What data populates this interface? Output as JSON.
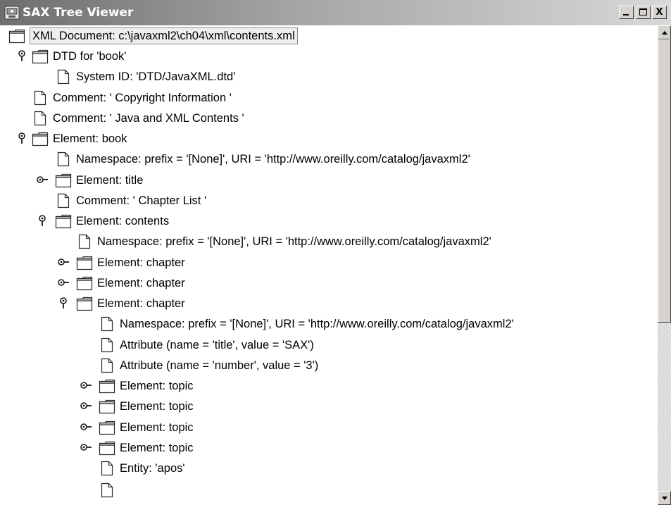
{
  "window": {
    "title": "SAX Tree Viewer",
    "buttons": {
      "minimize": "_",
      "maximize": "□",
      "close": "X"
    }
  },
  "tree": {
    "nodes": [
      {
        "label": "XML Document: c:\\javaxml2\\ch04\\xml\\contents.xml",
        "type": "folder",
        "depth": 0,
        "toggle": "none",
        "selected": true
      },
      {
        "label": "DTD for 'book'",
        "type": "folder",
        "depth": 0,
        "toggle": "expanded"
      },
      {
        "label": "System ID: 'DTD/JavaXML.dtd'",
        "type": "leaf",
        "depth": 1,
        "toggle": "none"
      },
      {
        "label": "Comment: ' Copyright Information '",
        "type": "leaf",
        "depth": 0,
        "toggle": "none"
      },
      {
        "label": "Comment: ' Java and XML Contents '",
        "type": "leaf",
        "depth": 0,
        "toggle": "none"
      },
      {
        "label": "Element: book",
        "type": "folder",
        "depth": 0,
        "toggle": "expanded"
      },
      {
        "label": "Namespace: prefix = '[None]', URI = 'http://www.oreilly.com/catalog/javaxml2'",
        "type": "leaf",
        "depth": 1,
        "toggle": "none"
      },
      {
        "label": "Element: title",
        "type": "folder",
        "depth": 1,
        "toggle": "collapsed"
      },
      {
        "label": "Comment: ' Chapter List '",
        "type": "leaf",
        "depth": 1,
        "toggle": "none"
      },
      {
        "label": "Element: contents",
        "type": "folder",
        "depth": 1,
        "toggle": "expanded"
      },
      {
        "label": "Namespace: prefix = '[None]', URI = 'http://www.oreilly.com/catalog/javaxml2'",
        "type": "leaf",
        "depth": 2,
        "toggle": "none"
      },
      {
        "label": "Element: chapter",
        "type": "folder",
        "depth": 2,
        "toggle": "collapsed"
      },
      {
        "label": "Element: chapter",
        "type": "folder",
        "depth": 2,
        "toggle": "collapsed"
      },
      {
        "label": "Element: chapter",
        "type": "folder",
        "depth": 2,
        "toggle": "expanded"
      },
      {
        "label": "Namespace: prefix = '[None]', URI = 'http://www.oreilly.com/catalog/javaxml2'",
        "type": "leaf",
        "depth": 3,
        "toggle": "none"
      },
      {
        "label": "Attribute (name = 'title', value = 'SAX')",
        "type": "leaf",
        "depth": 3,
        "toggle": "none"
      },
      {
        "label": "Attribute (name = 'number', value = '3')",
        "type": "leaf",
        "depth": 3,
        "toggle": "none"
      },
      {
        "label": "Element: topic",
        "type": "folder",
        "depth": 3,
        "toggle": "collapsed"
      },
      {
        "label": "Element: topic",
        "type": "folder",
        "depth": 3,
        "toggle": "collapsed"
      },
      {
        "label": "Element: topic",
        "type": "folder",
        "depth": 3,
        "toggle": "collapsed"
      },
      {
        "label": "Element: topic",
        "type": "folder",
        "depth": 3,
        "toggle": "collapsed"
      },
      {
        "label": "Entity: 'apos'",
        "type": "leaf",
        "depth": 3,
        "toggle": "none"
      }
    ]
  },
  "colors": {
    "titlebar_dark": "#6e6e6e",
    "titlebar_light": "#d8d8d8",
    "chrome": "#d6d3ce"
  }
}
